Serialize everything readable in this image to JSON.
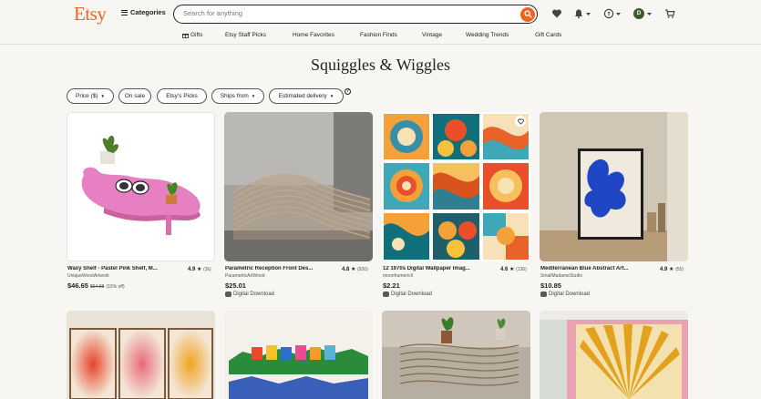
{
  "header": {
    "logo": "Etsy",
    "categories_label": "Categories",
    "search_placeholder": "Search for anything",
    "avatar_initial": "D"
  },
  "nav": {
    "items": [
      "Gifts",
      "Etsy Staff Picks",
      "Home Favorites",
      "Fashion Finds",
      "Vintage",
      "Wedding Trends",
      "Gift Cards"
    ]
  },
  "page_title": "Squiggles & Wiggles",
  "filters": {
    "price": "Price ($)",
    "on_sale": "On sale",
    "staff_picks": "Etsy's Picks",
    "ships_from": "Ships from",
    "delivery": "Estimated delivery"
  },
  "products": [
    {
      "title": "Waxy Shelf - Pastel Pink Shelf, M...",
      "rating": "4.9",
      "count": "(2k)",
      "shop": "UniqueWoodArtwork",
      "price": "$46.65",
      "original_price": "$54.88",
      "discount": "(15% off)",
      "delivery": ""
    },
    {
      "title": "Parametric Reception Front Des...",
      "rating": "4.8",
      "count": "(926)",
      "shop": "ParametricArtWood",
      "price": "$25.01",
      "original_price": "",
      "discount": "",
      "delivery": "Digital Download"
    },
    {
      "title": "12 1970s Digital Wallpaper Imag...",
      "rating": "4.6",
      "count": "(136)",
      "shop": "moonframerich",
      "price": "$2.21",
      "original_price": "",
      "discount": "",
      "delivery": "Digital Download"
    },
    {
      "title": "Mediterranean Blue Abstract Art...",
      "rating": "4.9",
      "count": "(55)",
      "shop": "SmallMadameStudio",
      "price": "$10.85",
      "original_price": "",
      "discount": "",
      "delivery": "Digital Download"
    }
  ],
  "colors": {
    "brand": "#f1641e",
    "background": "#f7f6f2"
  }
}
